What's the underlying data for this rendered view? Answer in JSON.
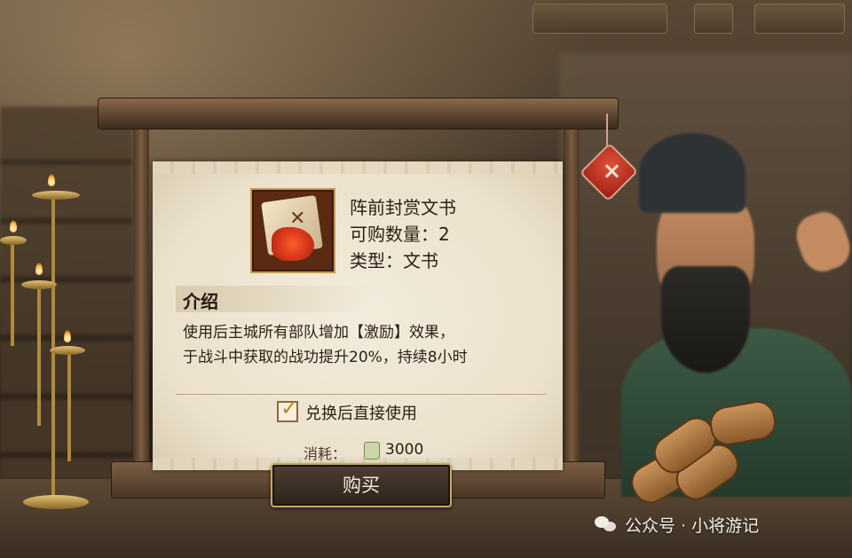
{
  "hud": {
    "cell1": "",
    "cell2": "",
    "cell3": ""
  },
  "item": {
    "name": "阵前封赏文书",
    "quantity": "可购数量：2",
    "type": "类型：文书"
  },
  "intro": {
    "title": "介绍",
    "line1": "使用后主城所有部队增加【激励】效果，",
    "line2": "于战斗中获取的战功提升20%，持续8小时"
  },
  "option": {
    "label": "兑换后直接使用",
    "checked": true
  },
  "cost": {
    "label": "消耗：",
    "value": "3000"
  },
  "buy_button": "购买",
  "close_symbol": "×",
  "watermark": "公众号 · 小将游记",
  "icons": {
    "close": "close-icon",
    "check": "check-icon",
    "currency": "copper-coin-icon",
    "item": "scroll-item-icon",
    "wechat": "wechat-icon"
  }
}
